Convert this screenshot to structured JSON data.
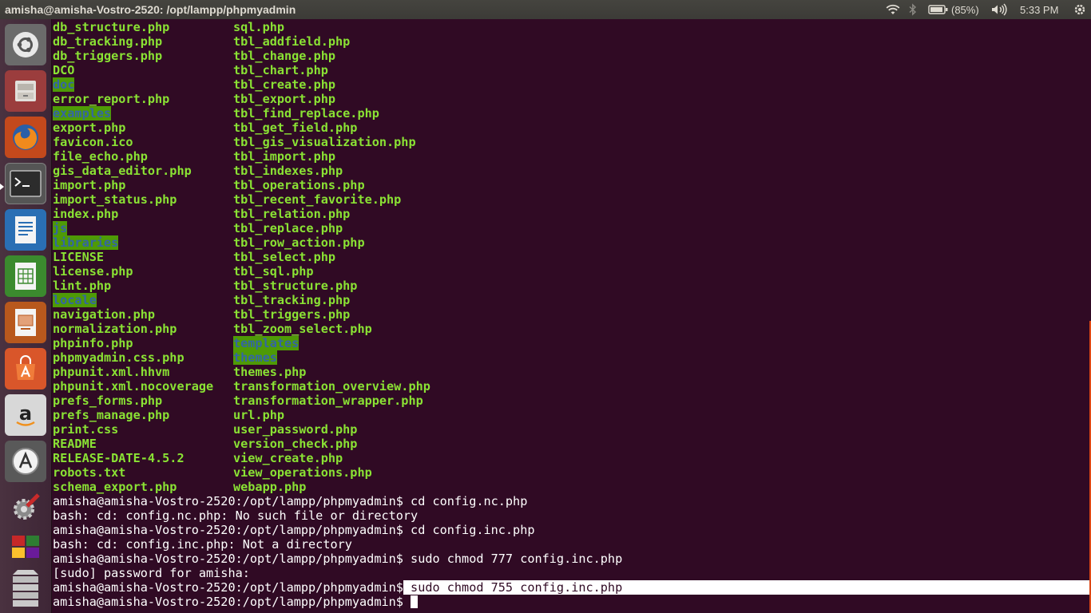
{
  "panel": {
    "title": "amisha@amisha-Vostro-2520: /opt/lampp/phpmyadmin",
    "battery_percent": "(85%)",
    "time": "5:33 PM"
  },
  "launcher": {
    "items": [
      {
        "name": "Dash home",
        "icon": "ubuntu-logo-icon"
      },
      {
        "name": "Files",
        "icon": "file-cabinet-icon"
      },
      {
        "name": "Firefox",
        "icon": "firefox-icon"
      },
      {
        "name": "Terminal",
        "icon": "terminal-icon"
      },
      {
        "name": "LibreOffice Writer",
        "icon": "document-icon"
      },
      {
        "name": "LibreOffice Calc",
        "icon": "spreadsheet-icon"
      },
      {
        "name": "LibreOffice Impress",
        "icon": "presentation-icon"
      },
      {
        "name": "Ubuntu Software Center",
        "icon": "shopping-bag-icon"
      },
      {
        "name": "Amazon",
        "icon": "amazon-icon"
      },
      {
        "name": "Software Updater",
        "icon": "updater-icon"
      },
      {
        "name": "System Settings",
        "icon": "settings-icon"
      },
      {
        "name": "Workspaces",
        "icon": "workspace-icon"
      },
      {
        "name": "Trash",
        "icon": "trash-icon"
      }
    ]
  },
  "terminal": {
    "listing": [
      {
        "left": {
          "text": "db_structure.php",
          "kind": "file"
        },
        "right": {
          "text": "sql.php",
          "kind": "file"
        }
      },
      {
        "left": {
          "text": "db_tracking.php",
          "kind": "file"
        },
        "right": {
          "text": "tbl_addfield.php",
          "kind": "file"
        }
      },
      {
        "left": {
          "text": "db_triggers.php",
          "kind": "file"
        },
        "right": {
          "text": "tbl_change.php",
          "kind": "file"
        }
      },
      {
        "left": {
          "text": "DCO",
          "kind": "file"
        },
        "right": {
          "text": "tbl_chart.php",
          "kind": "file"
        }
      },
      {
        "left": {
          "text": "doc",
          "kind": "dir"
        },
        "right": {
          "text": "tbl_create.php",
          "kind": "file"
        }
      },
      {
        "left": {
          "text": "error_report.php",
          "kind": "file"
        },
        "right": {
          "text": "tbl_export.php",
          "kind": "file"
        }
      },
      {
        "left": {
          "text": "examples",
          "kind": "dir"
        },
        "right": {
          "text": "tbl_find_replace.php",
          "kind": "file"
        }
      },
      {
        "left": {
          "text": "export.php",
          "kind": "file"
        },
        "right": {
          "text": "tbl_get_field.php",
          "kind": "file"
        }
      },
      {
        "left": {
          "text": "favicon.ico",
          "kind": "file"
        },
        "right": {
          "text": "tbl_gis_visualization.php",
          "kind": "file"
        }
      },
      {
        "left": {
          "text": "file_echo.php",
          "kind": "file"
        },
        "right": {
          "text": "tbl_import.php",
          "kind": "file"
        }
      },
      {
        "left": {
          "text": "gis_data_editor.php",
          "kind": "file"
        },
        "right": {
          "text": "tbl_indexes.php",
          "kind": "file"
        }
      },
      {
        "left": {
          "text": "import.php",
          "kind": "file"
        },
        "right": {
          "text": "tbl_operations.php",
          "kind": "file"
        }
      },
      {
        "left": {
          "text": "import_status.php",
          "kind": "file"
        },
        "right": {
          "text": "tbl_recent_favorite.php",
          "kind": "file"
        }
      },
      {
        "left": {
          "text": "index.php",
          "kind": "file"
        },
        "right": {
          "text": "tbl_relation.php",
          "kind": "file"
        }
      },
      {
        "left": {
          "text": "js",
          "kind": "dir"
        },
        "right": {
          "text": "tbl_replace.php",
          "kind": "file"
        }
      },
      {
        "left": {
          "text": "libraries",
          "kind": "dir"
        },
        "right": {
          "text": "tbl_row_action.php",
          "kind": "file"
        }
      },
      {
        "left": {
          "text": "LICENSE",
          "kind": "file"
        },
        "right": {
          "text": "tbl_select.php",
          "kind": "file"
        }
      },
      {
        "left": {
          "text": "license.php",
          "kind": "file"
        },
        "right": {
          "text": "tbl_sql.php",
          "kind": "file"
        }
      },
      {
        "left": {
          "text": "lint.php",
          "kind": "file"
        },
        "right": {
          "text": "tbl_structure.php",
          "kind": "file"
        }
      },
      {
        "left": {
          "text": "locale",
          "kind": "dir"
        },
        "right": {
          "text": "tbl_tracking.php",
          "kind": "file"
        }
      },
      {
        "left": {
          "text": "navigation.php",
          "kind": "file"
        },
        "right": {
          "text": "tbl_triggers.php",
          "kind": "file"
        }
      },
      {
        "left": {
          "text": "normalization.php",
          "kind": "file"
        },
        "right": {
          "text": "tbl_zoom_select.php",
          "kind": "file"
        }
      },
      {
        "left": {
          "text": "phpinfo.php",
          "kind": "file"
        },
        "right": {
          "text": "templates",
          "kind": "dir"
        }
      },
      {
        "left": {
          "text": "phpmyadmin.css.php",
          "kind": "file"
        },
        "right": {
          "text": "themes",
          "kind": "dir"
        }
      },
      {
        "left": {
          "text": "phpunit.xml.hhvm",
          "kind": "file"
        },
        "right": {
          "text": "themes.php",
          "kind": "file"
        }
      },
      {
        "left": {
          "text": "phpunit.xml.nocoverage",
          "kind": "file"
        },
        "right": {
          "text": "transformation_overview.php",
          "kind": "file"
        }
      },
      {
        "left": {
          "text": "prefs_forms.php",
          "kind": "file"
        },
        "right": {
          "text": "transformation_wrapper.php",
          "kind": "file"
        }
      },
      {
        "left": {
          "text": "prefs_manage.php",
          "kind": "file"
        },
        "right": {
          "text": "url.php",
          "kind": "file"
        }
      },
      {
        "left": {
          "text": "print.css",
          "kind": "file"
        },
        "right": {
          "text": "user_password.php",
          "kind": "file"
        }
      },
      {
        "left": {
          "text": "README",
          "kind": "file"
        },
        "right": {
          "text": "version_check.php",
          "kind": "file"
        }
      },
      {
        "left": {
          "text": "RELEASE-DATE-4.5.2",
          "kind": "file"
        },
        "right": {
          "text": "view_create.php",
          "kind": "file"
        }
      },
      {
        "left": {
          "text": "robots.txt",
          "kind": "file"
        },
        "right": {
          "text": "view_operations.php",
          "kind": "file"
        }
      },
      {
        "left": {
          "text": "schema_export.php",
          "kind": "file"
        },
        "right": {
          "text": "webapp.php",
          "kind": "file"
        }
      }
    ],
    "lines": [
      {
        "prompt": "amisha@amisha-Vostro-2520:/opt/lampp/phpmyadmin$",
        "text": " cd config.nc.php"
      },
      {
        "prompt": "",
        "text": "bash: cd: config.nc.php: No such file or directory"
      },
      {
        "prompt": "amisha@amisha-Vostro-2520:/opt/lampp/phpmyadmin$",
        "text": " cd config.inc.php"
      },
      {
        "prompt": "",
        "text": "bash: cd: config.inc.php: Not a directory"
      },
      {
        "prompt": "amisha@amisha-Vostro-2520:/opt/lampp/phpmyadmin$",
        "text": " sudo chmod 777 config.inc.php"
      },
      {
        "prompt": "",
        "text": "[sudo] password for amisha:"
      },
      {
        "prompt": "amisha@amisha-Vostro-2520:/opt/lampp/phpmyadmin$",
        "text": " sudo chmod 755 config.inc.php",
        "selected": true
      },
      {
        "prompt": "amisha@amisha-Vostro-2520:/opt/lampp/phpmyadmin$",
        "text": " ",
        "cursor": true
      }
    ]
  },
  "colors": {
    "terminal_bg": "#300a24",
    "file_text": "#8ae234",
    "dir_bg": "#4e9a06",
    "dir_text": "#3465a4",
    "selection_bg": "#ffffff"
  }
}
